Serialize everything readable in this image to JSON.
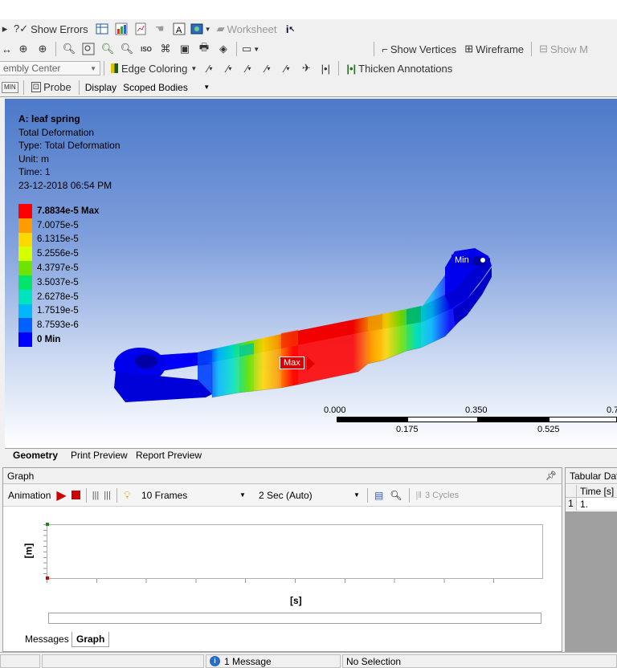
{
  "toolbar1": {
    "show_errors": "Show Errors",
    "worksheet": "Worksheet"
  },
  "toolbar2": {
    "show_vertices": "Show Vertices",
    "wireframe": "Wireframe",
    "show_mesh": "Show M"
  },
  "toolbar3": {
    "assembly_center": "embly Center",
    "edge_coloring": "Edge Coloring",
    "thicken_annotations": "Thicken Annotations"
  },
  "toolbar4": {
    "probe": "Probe",
    "display": "Display",
    "scoped_bodies": "Scoped Bodies"
  },
  "result": {
    "title": "A: leaf spring",
    "name": "Total Deformation",
    "type": "Type: Total Deformation",
    "unit": "Unit: m",
    "time": "Time: 1",
    "date": "23-12-2018 06:54 PM"
  },
  "legend": [
    {
      "value": "7.8834e-5 Max",
      "color": "#ff0000"
    },
    {
      "value": "7.0075e-5",
      "color": "#ff9d00"
    },
    {
      "value": "6.1315e-5",
      "color": "#ffd800"
    },
    {
      "value": "5.2556e-5",
      "color": "#d6ff00"
    },
    {
      "value": "4.3797e-5",
      "color": "#6fe400"
    },
    {
      "value": "3.5037e-5",
      "color": "#00e56a"
    },
    {
      "value": "2.6278e-5",
      "color": "#00e3c0"
    },
    {
      "value": "1.7519e-5",
      "color": "#00b6ff"
    },
    {
      "value": "8.7593e-6",
      "color": "#0061ff"
    },
    {
      "value": "0 Min",
      "color": "#0000ff"
    }
  ],
  "probes": {
    "max": "Max",
    "min": "Min"
  },
  "scale": {
    "top_ticks": [
      "0.000",
      "0.350",
      "0.7"
    ],
    "bottom_ticks": [
      "0.175",
      "0.525"
    ]
  },
  "view_tabs": [
    "Geometry",
    "Print Preview",
    "Report Preview"
  ],
  "graph": {
    "header": "Graph",
    "animation": "Animation",
    "frames": "10 Frames",
    "duration": "2 Sec (Auto)",
    "cycles": "3 Cycles",
    "ylabel": "[m]",
    "xlabel": "[s]"
  },
  "tabular": {
    "header": "Tabular Data",
    "col_time": "Time [s]",
    "row_num": "1",
    "row_val": "1."
  },
  "bottom_tabs": [
    "Messages",
    "Graph"
  ],
  "status": {
    "messages": "1 Message",
    "selection": "No Selection"
  }
}
